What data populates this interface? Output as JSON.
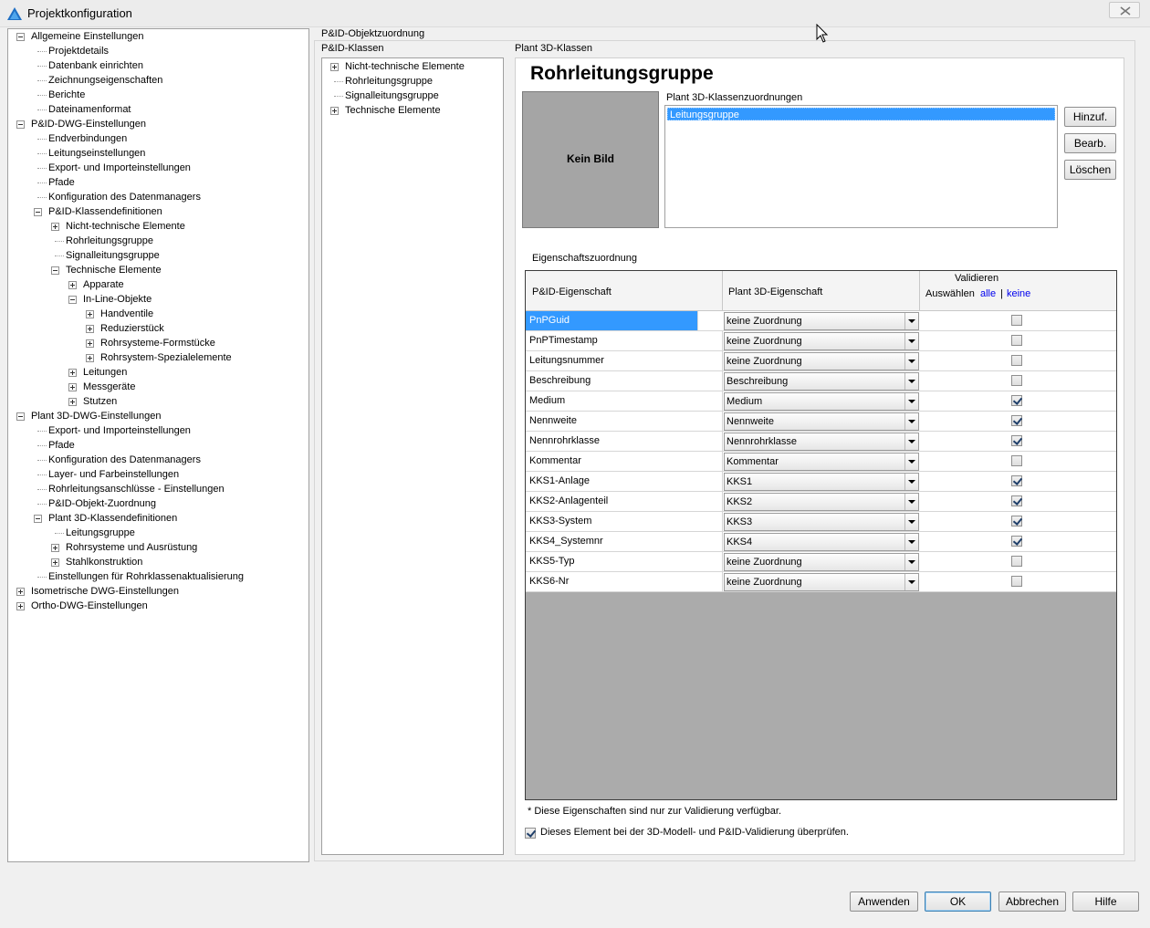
{
  "window": {
    "title": "Projektkonfiguration"
  },
  "left_tree": [
    {
      "label": "Allgemeine Einstellungen",
      "level": 0,
      "expander": "minus"
    },
    {
      "label": "Projektdetails",
      "level": 1,
      "expander": ""
    },
    {
      "label": "Datenbank einrichten",
      "level": 1,
      "expander": ""
    },
    {
      "label": "Zeichnungseigenschaften",
      "level": 1,
      "expander": ""
    },
    {
      "label": "Berichte",
      "level": 1,
      "expander": ""
    },
    {
      "label": "Dateinamenformat",
      "level": 1,
      "expander": ""
    },
    {
      "label": "P&ID-DWG-Einstellungen",
      "level": 0,
      "expander": "minus"
    },
    {
      "label": "Endverbindungen",
      "level": 1,
      "expander": ""
    },
    {
      "label": "Leitungseinstellungen",
      "level": 1,
      "expander": ""
    },
    {
      "label": "Export- und Importeinstellungen",
      "level": 1,
      "expander": ""
    },
    {
      "label": "Pfade",
      "level": 1,
      "expander": ""
    },
    {
      "label": "Konfiguration des Datenmanagers",
      "level": 1,
      "expander": ""
    },
    {
      "label": "P&ID-Klassendefinitionen",
      "level": 1,
      "expander": "minus"
    },
    {
      "label": "Nicht-technische Elemente",
      "level": 2,
      "expander": "plus"
    },
    {
      "label": "Rohrleitungsgruppe",
      "level": 2,
      "expander": ""
    },
    {
      "label": "Signalleitungsgruppe",
      "level": 2,
      "expander": ""
    },
    {
      "label": "Technische Elemente",
      "level": 2,
      "expander": "minus"
    },
    {
      "label": "Apparate",
      "level": 3,
      "expander": "plus"
    },
    {
      "label": "In-Line-Objekte",
      "level": 3,
      "expander": "minus"
    },
    {
      "label": "Handventile",
      "level": 4,
      "expander": "plus"
    },
    {
      "label": "Reduzierstück",
      "level": 4,
      "expander": "plus"
    },
    {
      "label": "Rohrsysteme-Formstücke",
      "level": 4,
      "expander": "plus"
    },
    {
      "label": "Rohrsystem-Spezialelemente",
      "level": 4,
      "expander": "plus"
    },
    {
      "label": "Leitungen",
      "level": 3,
      "expander": "plus"
    },
    {
      "label": "Messgeräte",
      "level": 3,
      "expander": "plus"
    },
    {
      "label": "Stutzen",
      "level": 3,
      "expander": "plus"
    },
    {
      "label": "Plant 3D-DWG-Einstellungen",
      "level": 0,
      "expander": "minus"
    },
    {
      "label": "Export- und Importeinstellungen",
      "level": 1,
      "expander": ""
    },
    {
      "label": "Pfade",
      "level": 1,
      "expander": ""
    },
    {
      "label": "Konfiguration des Datenmanagers",
      "level": 1,
      "expander": ""
    },
    {
      "label": "Layer- und Farbeinstellungen",
      "level": 1,
      "expander": ""
    },
    {
      "label": "Rohrleitungsanschlüsse - Einstellungen",
      "level": 1,
      "expander": ""
    },
    {
      "label": "P&ID-Objekt-Zuordnung",
      "level": 1,
      "expander": ""
    },
    {
      "label": "Plant 3D-Klassendefinitionen",
      "level": 1,
      "expander": "minus"
    },
    {
      "label": "Leitungsgruppe",
      "level": 2,
      "expander": ""
    },
    {
      "label": "Rohrsysteme und Ausrüstung",
      "level": 2,
      "expander": "plus"
    },
    {
      "label": "Stahlkonstruktion",
      "level": 2,
      "expander": "plus"
    },
    {
      "label": "Einstellungen für Rohrklassenaktualisierung",
      "level": 1,
      "expander": ""
    },
    {
      "label": "Isometrische DWG-Einstellungen",
      "level": 0,
      "expander": "plus"
    },
    {
      "label": "Ortho-DWG-Einstellungen",
      "level": 0,
      "expander": "plus"
    }
  ],
  "section": {
    "title": "P&ID-Objektzuordnung",
    "pid_classes_label": "P&ID-Klassen",
    "plant_classes_label": "Plant 3D-Klassen"
  },
  "class_tree": [
    {
      "label": "Nicht-technische Elemente",
      "expander": "plus"
    },
    {
      "label": "Rohrleitungsgruppe",
      "expander": ""
    },
    {
      "label": "Signalleitungsgruppe",
      "expander": ""
    },
    {
      "label": "Technische Elemente",
      "expander": "plus"
    }
  ],
  "detail": {
    "heading": "Rohrleitungsgruppe",
    "no_image": "Kein Bild",
    "mapping_label": "Plant 3D-Klassenzuordnungen",
    "mapping_items": [
      "Leitungsgruppe"
    ],
    "add_button": "Hinzuf.",
    "edit_button": "Bearb.",
    "delete_button": "Löschen"
  },
  "property_mapping": {
    "label": "Eigenschaftszuordnung",
    "col_pid": "P&ID-Eigenschaft",
    "col_plant": "Plant 3D-Eigenschaft",
    "col_validate": "Validieren",
    "select_label": "Auswählen",
    "select_all": "alle",
    "separator": "|",
    "select_none": "keine",
    "rows": [
      {
        "pid": "PnPGuid",
        "plant": "keine Zuordnung",
        "validate": false,
        "selected": true
      },
      {
        "pid": "PnPTimestamp",
        "plant": "keine Zuordnung",
        "validate": false,
        "selected": false
      },
      {
        "pid": "Leitungsnummer",
        "plant": "keine Zuordnung",
        "validate": false,
        "selected": false
      },
      {
        "pid": "Beschreibung",
        "plant": "Beschreibung",
        "validate": false,
        "selected": false
      },
      {
        "pid": "Medium",
        "plant": "Medium",
        "validate": true,
        "selected": false
      },
      {
        "pid": "Nennweite",
        "plant": "Nennweite",
        "validate": true,
        "selected": false
      },
      {
        "pid": "Nennrohrklasse",
        "plant": "Nennrohrklasse",
        "validate": true,
        "selected": false
      },
      {
        "pid": "Kommentar",
        "plant": "Kommentar",
        "validate": false,
        "selected": false
      },
      {
        "pid": "KKS1-Anlage",
        "plant": "KKS1",
        "validate": true,
        "selected": false
      },
      {
        "pid": "KKS2-Anlagenteil",
        "plant": "KKS2",
        "validate": true,
        "selected": false
      },
      {
        "pid": "KKS3-System",
        "plant": "KKS3",
        "validate": true,
        "selected": false
      },
      {
        "pid": "KKS4_Systemnr",
        "plant": "KKS4",
        "validate": true,
        "selected": false
      },
      {
        "pid": "KKS5-Typ",
        "plant": "keine Zuordnung",
        "validate": false,
        "selected": false
      },
      {
        "pid": "KKS6-Nr",
        "plant": "keine Zuordnung",
        "validate": false,
        "selected": false
      }
    ],
    "footnote": "* Diese Eigenschaften sind nur zur Validierung verfügbar.",
    "validate_element_label": "Dieses Element bei der 3D-Modell- und P&ID-Validierung überprüfen.",
    "validate_element_checked": true
  },
  "buttons": {
    "apply": "Anwenden",
    "ok": "OK",
    "cancel": "Abbrechen",
    "help": "Hilfe"
  },
  "colors": {
    "selection": "#3399ff",
    "grid_empty": "#ababab",
    "no_image_bg": "#a5a5a5",
    "link": "#0000ee"
  },
  "icons": {
    "app": "autodesk-plant-logo-icon",
    "close": "close-icon",
    "cursor": "mouse-cursor-icon"
  }
}
